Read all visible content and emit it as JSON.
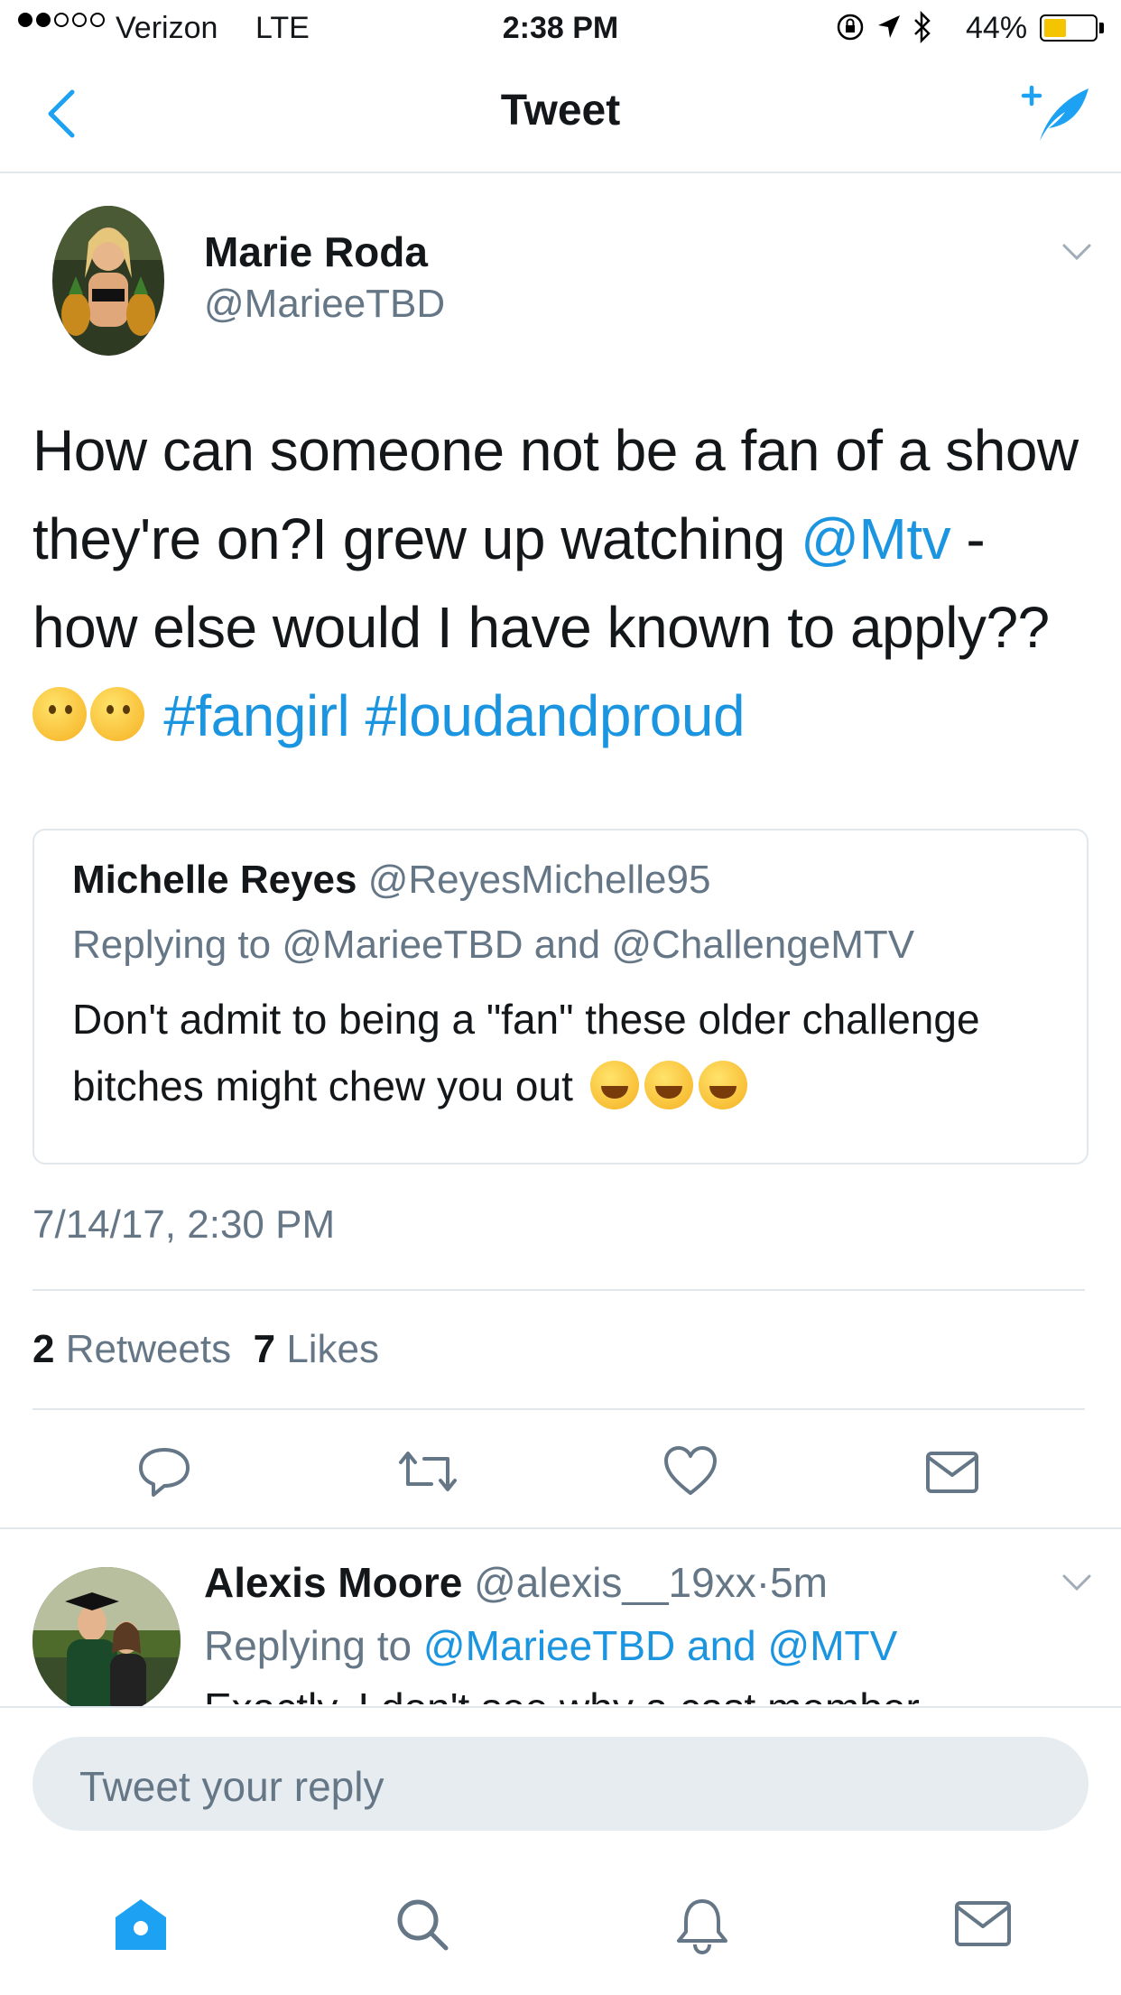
{
  "status_bar": {
    "carrier": "Verizon",
    "network": "LTE",
    "time": "2:38 PM",
    "battery": "44%",
    "battery_level": 0.44,
    "signal_bars": 2,
    "icons": [
      "rotation-lock-icon",
      "location-icon",
      "bluetooth-icon"
    ]
  },
  "nav": {
    "title": "Tweet",
    "back_icon": "chevron-left-icon",
    "compose_icon": "compose-tweet-icon"
  },
  "tweet": {
    "author_name": "Marie Roda",
    "author_handle": "@MarieeTBD",
    "text": {
      "part1": "How can someone not be a fan of a show they're on?I grew up watching ",
      "mention": "@Mtv",
      "part2": " - how else would I have known to apply?? ",
      "emoji": "thinking-face-emoji",
      "hashtag1": "#fangirl",
      "hashtag2": "#loudandproud"
    },
    "quoted": {
      "name": "Michelle Reyes",
      "handle": "@ReyesMichelle95",
      "replying_to": "Replying to @MarieeTBD and @ChallengeMTV",
      "text": "Don't admit to being a \"fan\" these older challenge bitches might chew you out",
      "emoji": "face-with-tears-of-joy-emoji"
    },
    "timestamp": "7/14/17, 2:30 PM",
    "retweets_count": "2",
    "retweets_label": "Retweets",
    "likes_count": "7",
    "likes_label": "Likes"
  },
  "reply": {
    "name": "Alexis Moore",
    "handle": "@alexis__19xx",
    "separator": "·",
    "age": "5m",
    "replying_prefix": "Replying to",
    "replying_handles": "@MarieeTBD and @MTV",
    "text": "Exactly. I don't see why a cast member"
  },
  "composer": {
    "placeholder": "Tweet your reply"
  },
  "tabs": [
    "home-icon",
    "search-icon",
    "notifications-icon",
    "messages-icon"
  ],
  "colors": {
    "accent": "#1da1f2",
    "link": "#1b95e0",
    "secondary_text": "#657786",
    "divider": "#e1e8ed"
  }
}
